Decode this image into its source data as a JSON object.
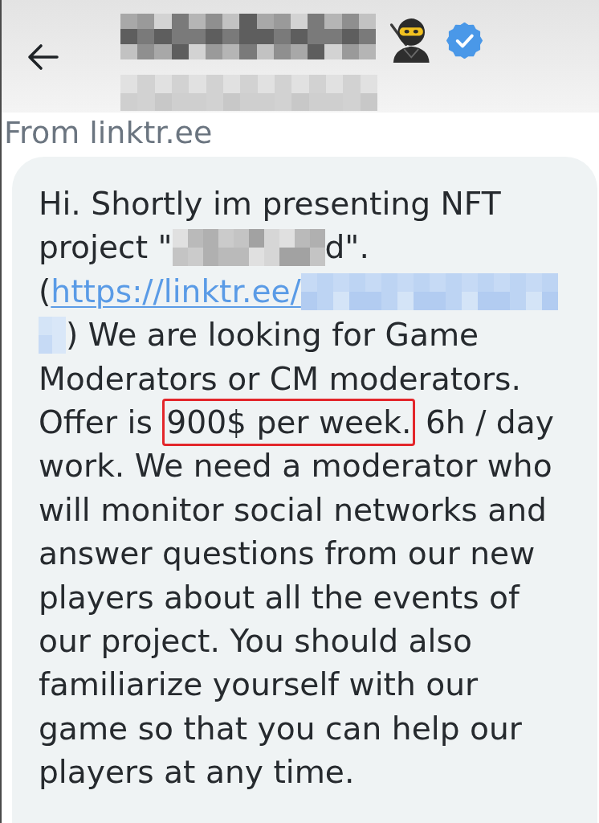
{
  "header": {
    "verified": true
  },
  "source_note": "From linktr.ee",
  "message": {
    "segments": [
      {
        "kind": "text",
        "text": "Hi. Shortly im presenting NFT project \""
      },
      {
        "kind": "redacted"
      },
      {
        "kind": "text",
        "text": "d\". ("
      },
      {
        "kind": "link",
        "text": "https://linktr.ee/"
      },
      {
        "kind": "redacted_link"
      },
      {
        "kind": "redacted_link"
      },
      {
        "kind": "text",
        "text": ") We are looking for Game Moderators or CM moderators. Offer is "
      },
      {
        "kind": "highlight",
        "text": "900$ per week."
      },
      {
        "kind": "text",
        "text": " 6h / day work. We need a moderator who will monitor social networks and answer questions from our new players about all the events of our project. You should also familiarize yourself with our game so that you can help our players at any time."
      }
    ]
  }
}
